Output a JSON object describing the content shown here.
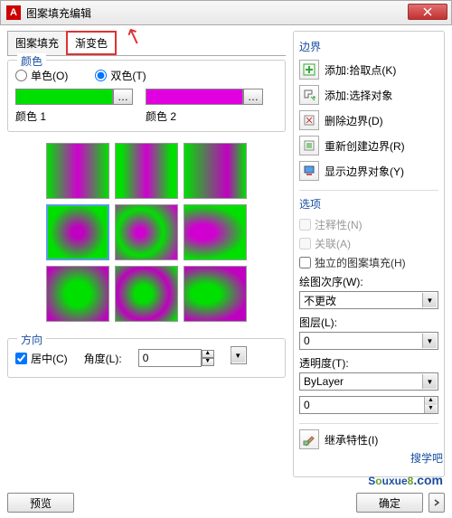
{
  "window": {
    "title": "图案填充编辑"
  },
  "tabs": {
    "t1": "图案填充",
    "t2": "渐变色"
  },
  "color": {
    "group": "颜色",
    "single": "单色(O)",
    "double": "双色(T)",
    "label1": "颜色 1",
    "label2": "颜色 2"
  },
  "direction": {
    "group": "方向",
    "center": "居中(C)",
    "angle": "角度(L):",
    "angle_value": "0"
  },
  "boundary": {
    "title": "边界",
    "add_pick": "添加:拾取点(K)",
    "add_select": "添加:选择对象",
    "delete": "删除边界(D)",
    "recreate": "重新创建边界(R)",
    "show": "显示边界对象(Y)"
  },
  "options": {
    "title": "选项",
    "annotative": "注释性(N)",
    "associative": "关联(A)",
    "independent": "独立的图案填充(H)",
    "draw_order_label": "绘图次序(W):",
    "draw_order_value": "不更改",
    "layer_label": "图层(L):",
    "layer_value": "0",
    "transparency_label": "透明度(T):",
    "transparency_value": "ByLayer",
    "slider_value": "0"
  },
  "inherit": "继承特性(I)",
  "buttons": {
    "preview": "预览",
    "ok": "确定"
  },
  "watermark": {
    "line1": "搜学吧",
    "brand1": "S",
    "brand_oo": "o",
    "brand2": "uxue",
    "brand3": "8",
    "suffix": ".com"
  }
}
